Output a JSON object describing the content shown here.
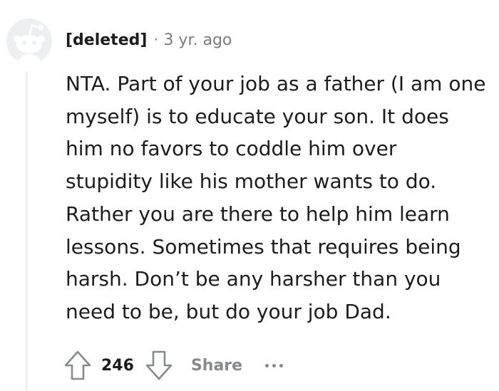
{
  "comment": {
    "author": "[deleted]",
    "separator": "·",
    "time": "3 yr. ago",
    "body": "NTA. Part of your job as a father (I am one\nmyself) is to educate your son. It does\nhim no favors to coddle him over\nstupidity like his mother wants to do.\nRather you are there to help him learn\nlessons. Sometimes that requires being\nharsh. Don’t be any harsher than you\nneed to be, but do your job Dad."
  },
  "actions": {
    "score": "246",
    "share_label": "Share"
  },
  "icons": {
    "avatar": "reddit-snoo-avatar-icon",
    "upvote": "upvote-arrow-icon",
    "downvote": "downvote-arrow-icon",
    "more": "more-options-icon"
  },
  "colors": {
    "avatar_bg": "#edeff1",
    "avatar_fg": "#ffffff",
    "thread_line": "#edeff1",
    "muted": "#878a8c",
    "text": "#1c1c1c"
  }
}
